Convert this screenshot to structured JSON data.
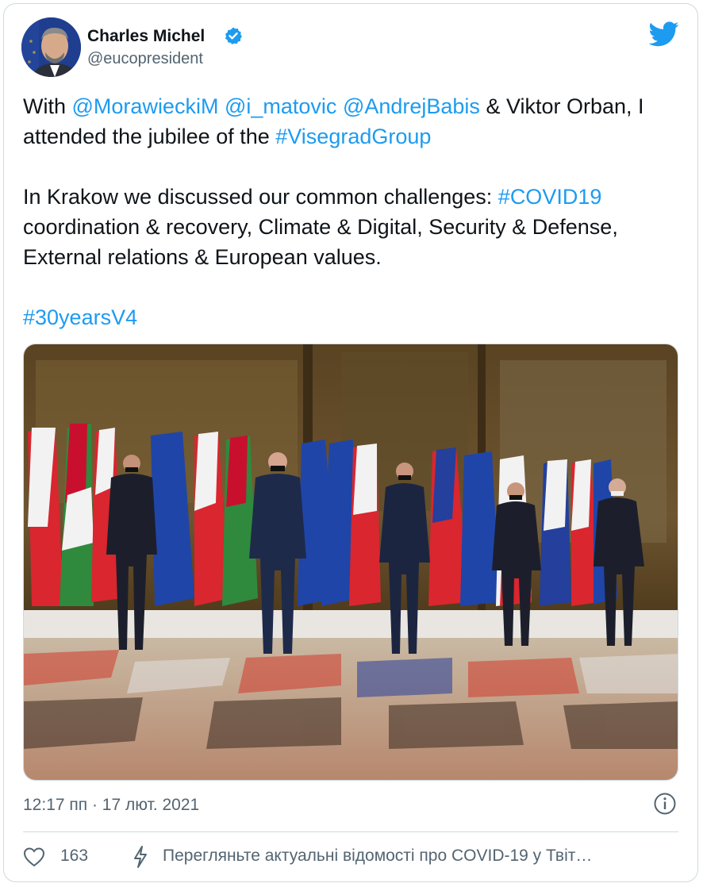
{
  "author": {
    "name": "Charles Michel",
    "handle": "@eucopresident",
    "verified": true
  },
  "tweet": {
    "segments": [
      [
        {
          "text": "With ",
          "type": "text"
        },
        {
          "text": "@MorawieckiM",
          "type": "link"
        },
        {
          "text": " ",
          "type": "text"
        },
        {
          "text": "@i_matovic",
          "type": "link"
        },
        {
          "text": " ",
          "type": "text"
        },
        {
          "text": "@AndrejBabis",
          "type": "link"
        },
        {
          "text": " & Viktor Orban, I attended the jubilee of the ",
          "type": "text"
        },
        {
          "text": "#VisegradGroup",
          "type": "link"
        }
      ],
      [
        {
          "text": "In Krakow we discussed our common challenges: ",
          "type": "text"
        },
        {
          "text": "#COVID19",
          "type": "link"
        },
        {
          "text": " coordination & recovery, Climate & Digital, Security & Defense, External relations & European values.",
          "type": "text"
        }
      ],
      [
        {
          "text": "#30yearsV4",
          "type": "link"
        }
      ]
    ]
  },
  "timestamp": "12:17 пп · 17 лют. 2021",
  "stats": {
    "likes": "163"
  },
  "covid_notice": "Перегляньте актуальні відомості про COVID-19 у Твіт…",
  "colors": {
    "link": "#1d9bf0",
    "text": "#0f1419",
    "muted": "#536471",
    "border": "#cfd9de"
  },
  "icons": {
    "verified": "verified-badge-icon",
    "brand": "twitter-bird-icon",
    "info": "info-icon",
    "like": "heart-icon",
    "covid": "lightning-bolt-icon"
  }
}
